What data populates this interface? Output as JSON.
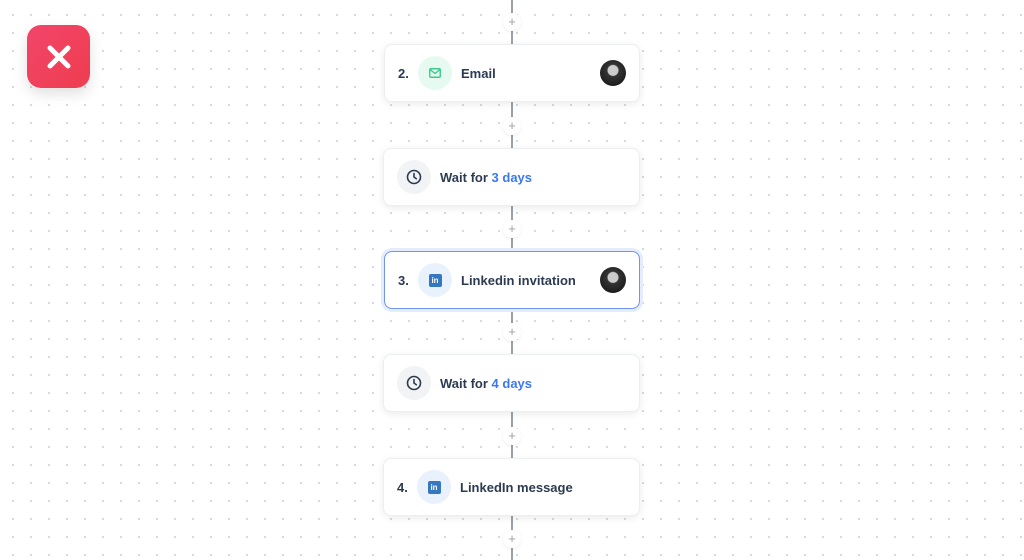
{
  "colors": {
    "close": "#ef4058",
    "accent": "#3b78f0",
    "linkedin": "#3677c1",
    "email": "#3ec98d"
  },
  "plus_label": "+",
  "steps": [
    {
      "number": "2.",
      "label": "Email",
      "icon": "mail-icon"
    },
    {
      "prefix": "Wait for",
      "value": "3 days",
      "icon": "clock-icon"
    },
    {
      "number": "3.",
      "label": "Linkedin invitation",
      "icon": "linkedin-icon",
      "selected": true
    },
    {
      "prefix": "Wait for",
      "value": "4 days",
      "icon": "clock-icon"
    },
    {
      "number": "4.",
      "label": "LinkedIn message",
      "icon": "linkedin-icon"
    }
  ],
  "linkedin_glyph": "in"
}
